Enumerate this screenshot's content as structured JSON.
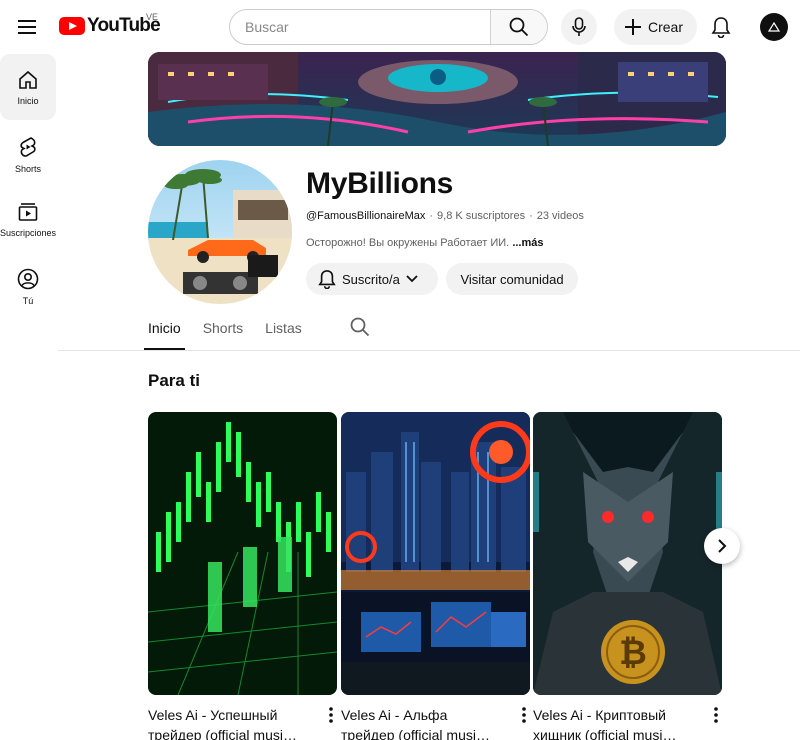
{
  "header": {
    "logo_text": "YouTube",
    "country_code": "VE",
    "search_placeholder": "Buscar",
    "create_label": "Crear"
  },
  "sidebar": {
    "items": [
      {
        "label": "Inicio",
        "icon": "home-icon",
        "active": true
      },
      {
        "label": "Shorts",
        "icon": "shorts-icon"
      },
      {
        "label": "Suscripciones",
        "icon": "subscriptions-icon"
      },
      {
        "label": "Tú",
        "icon": "you-icon"
      }
    ]
  },
  "channel": {
    "name": "MyBillions",
    "handle": "@FamousBillionaireMax",
    "subscribers": "9,8 K suscriptores",
    "videos": "23 videos",
    "description": "Осторожно!  Вы окружены  Работает ИИ.",
    "more_label": "...más",
    "subscribed_label": "Suscrito/a",
    "community_label": "Visitar comunidad"
  },
  "tabs": [
    {
      "label": "Inicio",
      "active": true
    },
    {
      "label": "Shorts"
    },
    {
      "label": "Listas"
    }
  ],
  "section": {
    "title": "Para ti"
  },
  "shorts": [
    {
      "title": "Veles Ai - Успешный трейдер (official music video)"
    },
    {
      "title": "Veles Ai - Альфа трейдер (official music video)"
    },
    {
      "title": "Veles Ai - Криптовый хищник (official music video)"
    }
  ],
  "shorts_display": [
    "Veles Ai - Успешный трейдер (official musi…",
    "Veles Ai - Альфа трейдер (official musi…",
    "Veles Ai - Криптовый хищник (official musi…"
  ],
  "colors": {
    "brand_red": "#ff0000",
    "chip_bg": "#f2f2f2",
    "text_primary": "#0f0f0f",
    "text_secondary": "#606060"
  }
}
